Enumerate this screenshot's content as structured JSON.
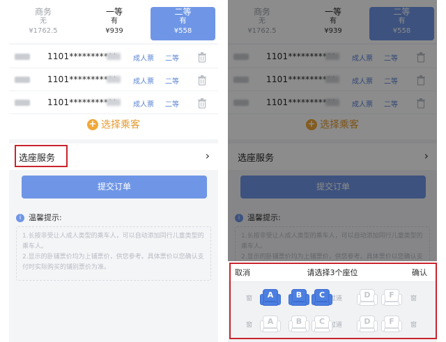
{
  "seat_classes": [
    {
      "name": "商务",
      "availability": "无",
      "price": "¥1762.5"
    },
    {
      "name": "一等",
      "availability": "有",
      "price": "¥939"
    },
    {
      "name": "二等",
      "availability": "有",
      "price": "¥558"
    }
  ],
  "passengers": [
    {
      "id": "1101***********",
      "ticket_type": "成人票",
      "seat_class": "二等"
    },
    {
      "id": "1101***********",
      "ticket_type": "成人票",
      "seat_class": "二等"
    },
    {
      "id": "1101***********",
      "ticket_type": "成人票",
      "seat_class": "二等"
    }
  ],
  "add_passenger_label": "选择乘客",
  "seat_service_label": "选座服务",
  "chevron": "›",
  "submit_label": "提交订单",
  "tips": {
    "title": "温馨提示:",
    "lines": [
      "1.长按非受让人成人类型的乘车人，可以自动添加同行儿童类型的乘车人。",
      "2.显示的卧铺票价均为上铺票价，供您参考。具体票价以您确认支付时实际购买的铺别票价为准。"
    ]
  },
  "seat_picker": {
    "cancel_label": "取消",
    "title": "请选择3个座位",
    "confirm_label": "确认",
    "window_label": "窗",
    "aisle_label": "过道",
    "rows": [
      {
        "seats": [
          {
            "letter": "A",
            "selected": true
          },
          {
            "letter": "B",
            "selected": true
          },
          {
            "letter": "C",
            "selected": true
          },
          {
            "letter": "D",
            "selected": false
          },
          {
            "letter": "F",
            "selected": false
          }
        ]
      },
      {
        "seats": [
          {
            "letter": "A",
            "selected": false
          },
          {
            "letter": "B",
            "selected": false
          },
          {
            "letter": "C",
            "selected": false
          },
          {
            "letter": "D",
            "selected": false
          },
          {
            "letter": "F",
            "selected": false
          }
        ]
      }
    ]
  },
  "colors": {
    "primary": "#6f96e6",
    "accent": "#f0a83a",
    "highlight_border": "#c8232c"
  }
}
